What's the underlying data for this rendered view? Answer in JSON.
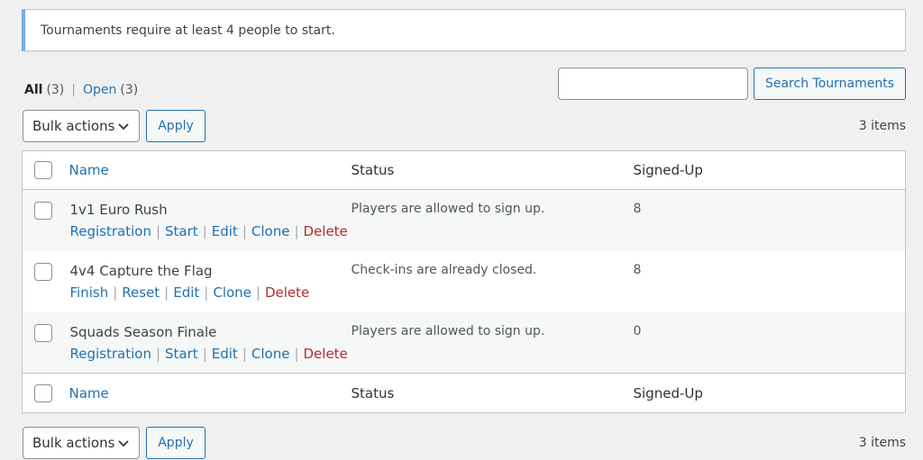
{
  "notice": {
    "text": "Tournaments require at least 4 people to start."
  },
  "views": {
    "all_label": "All",
    "all_count": "(3)",
    "open_label": "Open",
    "open_count": "(3)",
    "separator": "|"
  },
  "search": {
    "value": "",
    "placeholder": "",
    "button_label": "Search Tournaments"
  },
  "tablenav_top": {
    "bulk_label": "Bulk actions",
    "apply_label": "Apply",
    "items_count": "3 items"
  },
  "tablenav_bottom": {
    "bulk_label": "Bulk actions",
    "apply_label": "Apply",
    "items_count": "3 items"
  },
  "table": {
    "columns": {
      "name": "Name",
      "status": "Status",
      "signed_up": "Signed-Up"
    },
    "rows": [
      {
        "title": "1v1 Euro Rush",
        "status": "Players are allowed to sign up.",
        "signed_up": "8",
        "actions": [
          "Registration",
          "Start",
          "Edit",
          "Clone",
          "Delete"
        ]
      },
      {
        "title": "4v4 Capture the Flag",
        "status": "Check-ins are already closed.",
        "signed_up": "8",
        "actions": [
          "Finish",
          "Reset",
          "Edit",
          "Clone",
          "Delete"
        ]
      },
      {
        "title": "Squads Season Finale",
        "status": "Players are allowed to sign up.",
        "signed_up": "0",
        "actions": [
          "Registration",
          "Start",
          "Edit",
          "Clone",
          "Delete"
        ]
      }
    ],
    "action_separator": "|"
  },
  "colors": {
    "link": "#2271b1",
    "delete": "#b32d2e",
    "notice_border": "#72aee6",
    "background": "#f0f0f1"
  },
  "icons": {
    "select_arrow": "chevron-down-icon"
  }
}
